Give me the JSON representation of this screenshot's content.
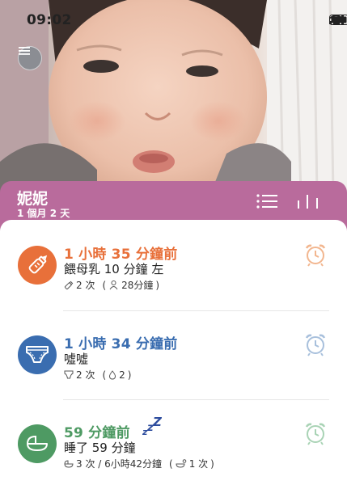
{
  "status_bar": {
    "time": "09:02"
  },
  "header": {
    "baby_name": "妮妮",
    "baby_age": "1 個月 2 天",
    "accent_color": "#b96b9c"
  },
  "entries": [
    {
      "type": "feeding",
      "icon": "bottle-icon",
      "color": "#e8703a",
      "time_ago": "1 小時 35 分鐘前",
      "description": "餵母乳 10 分鐘 左",
      "stats_count": "2 次",
      "stats_detail_prefix": "(",
      "stats_detail": "28分鐘",
      "stats_detail_suffix": ")"
    },
    {
      "type": "diaper",
      "icon": "diaper-icon",
      "color": "#3a6db0",
      "time_ago": "1 小時 34 分鐘前",
      "description": "噓噓",
      "stats_count": "2 次",
      "stats_detail_prefix": "(",
      "stats_detail": "2",
      "stats_detail_suffix": ")"
    },
    {
      "type": "sleep",
      "icon": "bassinet-icon",
      "color": "#4e9a63",
      "time_ago": "59 分鐘前",
      "description": "睡了 59 分鐘",
      "stats_count": "3 次 / 6小時42分鐘",
      "stats_detail_prefix": "(",
      "stats_detail": "1 次",
      "stats_detail_suffix": ")"
    }
  ]
}
